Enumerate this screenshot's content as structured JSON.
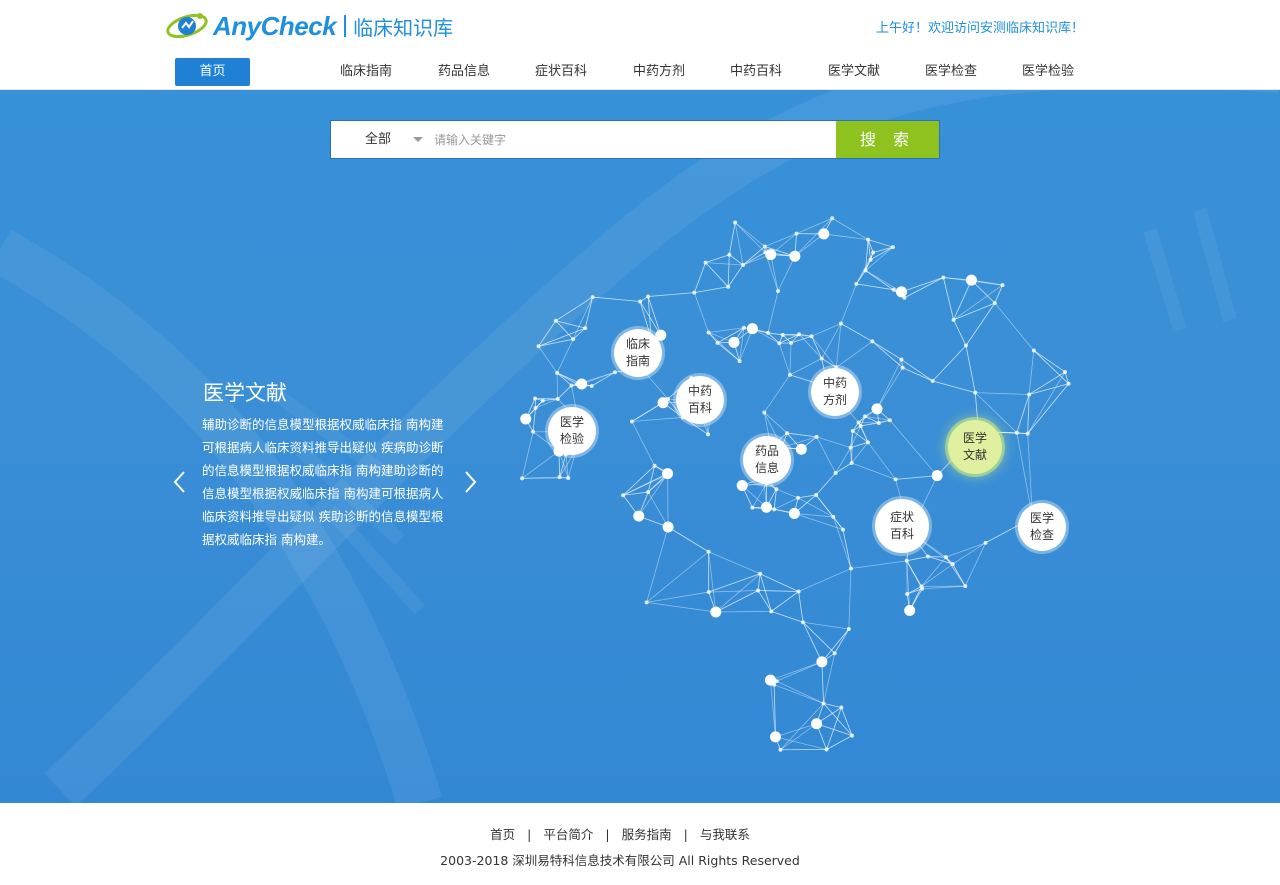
{
  "header": {
    "logo_text_any": "Any",
    "logo_text_check": "Check",
    "logo_subtitle": "临床知识库",
    "greeting": "上午好！欢迎访问安测临床知识库！"
  },
  "nav": {
    "items": [
      "首页",
      "临床指南",
      "药品信息",
      "症状百科",
      "中药方剂",
      "中药百科",
      "医学文献",
      "医学检查",
      "医学检验"
    ],
    "active": "首页"
  },
  "search": {
    "scope": "全部",
    "placeholder": "请输入关键字",
    "button": "搜 索"
  },
  "slide": {
    "title": "医学文献",
    "description": "辅助诊断的信息模型根据权威临床指 南构建可根据病人临床资料推导出疑似 疾病助诊断的信息模型根据权威临床指 南构建助诊断的信息模型根据权威临床指 南构建可根据病人临床资料推导出疑似 疾助诊断的信息模型根据权威临床指 南构建。"
  },
  "brain_nodes": [
    {
      "line1": "临床",
      "line2": "指南"
    },
    {
      "line1": "中药",
      "line2": "百科"
    },
    {
      "line1": "中药",
      "line2": "方剂"
    },
    {
      "line1": "医学",
      "line2": "检验"
    },
    {
      "line1": "药品",
      "line2": "信息"
    },
    {
      "line1": "医学",
      "line2": "文献",
      "active": true
    },
    {
      "line1": "症状",
      "line2": "百科"
    },
    {
      "line1": "医学",
      "line2": "检查"
    }
  ],
  "footer": {
    "links": [
      "首页",
      "平台简介",
      "服务指南",
      "与我联系"
    ],
    "copyright": "2003-2018 深圳易特科信息技术有限公司 All Rights Reserved"
  },
  "colors": {
    "brand_blue": "#1f80d6",
    "hero_bg": "#3a8fd6",
    "search_button": "#8dc21f",
    "active_node": "#dff0a0"
  }
}
